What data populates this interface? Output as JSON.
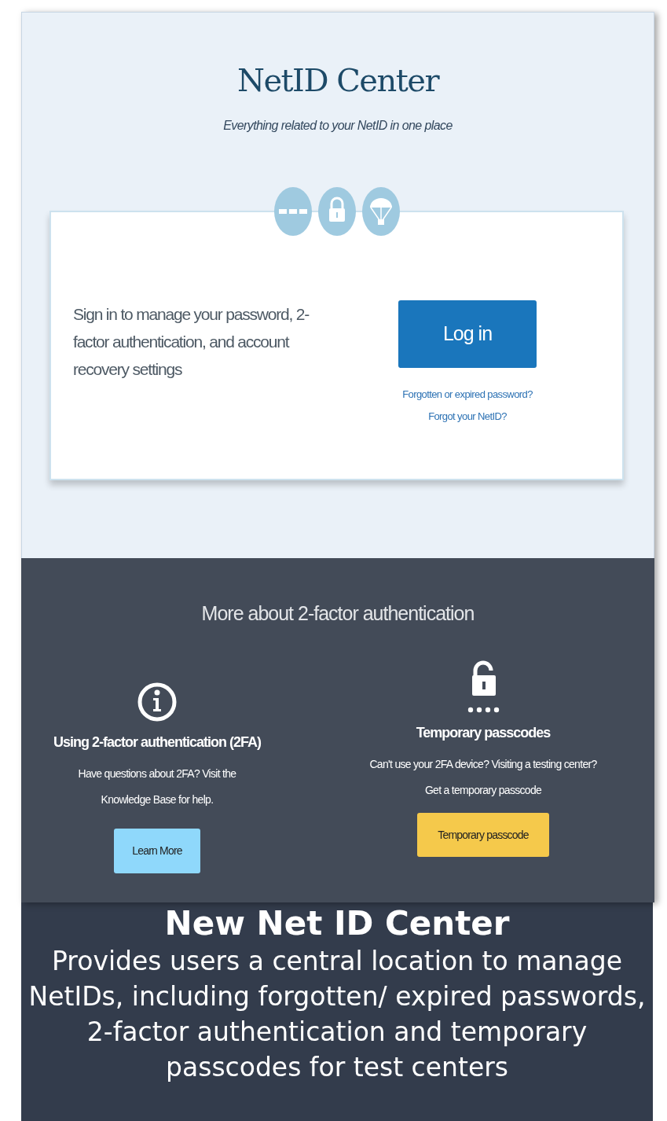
{
  "header": {
    "title": "NetID Center",
    "subtitle": "Everything related to your NetID in one place"
  },
  "login_card": {
    "description": "Sign in to manage your password, 2-factor authentication, and account recovery settings",
    "button": "Log in",
    "links": [
      "Forgotten or expired password?",
      "Forgot your NetID?"
    ]
  },
  "info_section": {
    "heading": "More about 2-factor authentication",
    "items": [
      {
        "kind": "info",
        "title": "Using 2-factor authentication (2FA)",
        "text": "Have questions about 2FA? Visit the Knowledge Base for help.",
        "button": "Learn More"
      },
      {
        "kind": "passcode",
        "title": "Temporary passcodes",
        "text": "Can't use your 2FA device? Visiting a testing center? Get a temporary passcode",
        "button": "Temporary passcode"
      }
    ]
  },
  "caption": {
    "title": "New Net ID Center",
    "text": "Provides users a central location to manage NetIDs, including forgotten/ expired passwords, 2-factor authentication and temporary passcodes for test centers"
  }
}
